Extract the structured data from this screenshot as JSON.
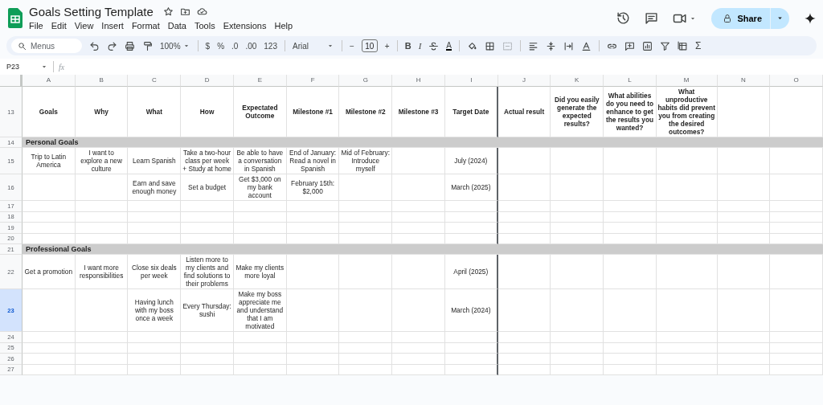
{
  "document": {
    "title": "Goals Setting Template"
  },
  "menu": [
    "File",
    "Edit",
    "View",
    "Insert",
    "Format",
    "Data",
    "Tools",
    "Extensions",
    "Help"
  ],
  "share_button": {
    "label": "Share"
  },
  "toolbar": {
    "search": {
      "placeholder": "Menus"
    },
    "zoom": "100%",
    "number_formats": [
      "$",
      "%",
      ".0",
      ".00",
      "123"
    ],
    "font": "Arial",
    "font_size": "10",
    "size_buttons": [
      "−",
      "+"
    ],
    "text_styles": [
      "B",
      "I"
    ],
    "text_color": "A",
    "merge_cells": {
      "disabled": true
    },
    "sum": "Σ"
  },
  "formula_bar": {
    "cell_ref": "P23",
    "fx": "fx"
  },
  "columns": [
    "A",
    "B",
    "C",
    "D",
    "E",
    "F",
    "G",
    "H",
    "I",
    "J",
    "K",
    "L",
    "M",
    "N",
    "O"
  ],
  "rows": [
    {
      "number": "13",
      "kind": "header",
      "selected": false,
      "cells": {
        "A": "Goals",
        "B": "Why",
        "C": "What",
        "D": "How",
        "E": "Expectated Outcome",
        "F": "Milestone #1",
        "G": "Milestone #2",
        "H": "Milestone #3",
        "I": "Target Date",
        "J": "Actual result",
        "K": "Did you easily generate the expected results?",
        "L": "What abilities do you need to enhance to get the results you wanted?",
        "M": "What unproductive habits did prevent you from creating the desired outcomes?"
      }
    },
    {
      "number": "14",
      "kind": "section",
      "selected": false,
      "label": "Personal Goals"
    },
    {
      "number": "15",
      "kind": "data",
      "selected": false,
      "cells": {
        "A": "Trip to Latin America",
        "B": "I want to explore a new culture",
        "C": "Learn Spanish",
        "D": "Take a two-hour class per week + Study at home",
        "E": "Be able to have a conversation in Spanish",
        "F": "End of January: Read a novel in Spanish",
        "G": "Mid of February: Introduce myself",
        "I": "July (2024)"
      }
    },
    {
      "number": "16",
      "kind": "data",
      "selected": false,
      "cells": {
        "C": "Earn and save enough money",
        "D": "Set a budget",
        "E": "Get $3,000 on my bank account",
        "F": "February 15th: $2,000",
        "I": "March (2025)"
      }
    },
    {
      "number": "17",
      "kind": "data",
      "selected": false
    },
    {
      "number": "18",
      "kind": "data",
      "selected": false
    },
    {
      "number": "19",
      "kind": "data",
      "selected": false
    },
    {
      "number": "20",
      "kind": "data",
      "selected": false
    },
    {
      "number": "21",
      "kind": "section",
      "selected": false,
      "label": "Professional Goals"
    },
    {
      "number": "22",
      "kind": "data",
      "selected": false,
      "cells": {
        "A": "Get a promotion",
        "B": "I want more responsibilities",
        "C": "Close six deals per week",
        "D": "Listen more to my clients and find solutions to their problems",
        "E": "Make my clients more loyal",
        "I": "April (2025)"
      }
    },
    {
      "number": "23",
      "kind": "data",
      "selected": true,
      "cells": {
        "C": "Having lunch with my boss once a week",
        "D": "Every Thursday: sushi",
        "E": "Make my boss appreciate me and understand that I am motivated",
        "I": "March (2024)"
      }
    },
    {
      "number": "24",
      "kind": "data",
      "selected": false
    },
    {
      "number": "25",
      "kind": "data",
      "selected": false
    },
    {
      "number": "26",
      "kind": "data",
      "selected": false
    },
    {
      "number": "27",
      "kind": "data",
      "selected": false
    }
  ]
}
